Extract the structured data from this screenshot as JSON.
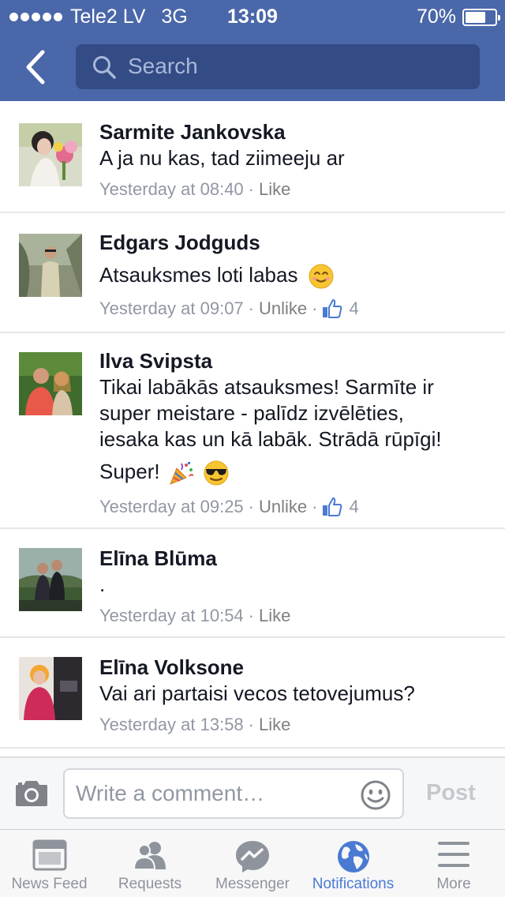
{
  "status_bar": {
    "carrier": "Tele2 LV",
    "network": "3G",
    "time": "13:09",
    "battery": "70%",
    "battery_level": 0.7
  },
  "header": {
    "search_placeholder": "Search",
    "colors": {
      "bar": "#4a67a9",
      "search": "#334c86"
    }
  },
  "comments": [
    {
      "name": "Sarmite Jankovska",
      "lines": [
        "A ja nu kas, tad ziimeeju ar"
      ],
      "time": "Yesterday at 08:40",
      "action": "Like",
      "likes": ""
    },
    {
      "name": "Edgars Jodguds",
      "lines": [
        "Atsauksmes loti labas"
      ],
      "emojis": [
        "smiling-face"
      ],
      "time": "Yesterday at 09:07",
      "action": "Unlike",
      "likes": "4"
    },
    {
      "name": "Ilva Svipsta",
      "lines": [
        "Tikai labākās atsauksmes! Sarmīte ir",
        "super meistare - palīdz izvēlēties,",
        "iesaka kas un kā labāk. Strādā rūpīgi!",
        "Super!"
      ],
      "emojis": [
        "party-popper",
        "sunglasses-face"
      ],
      "time": "Yesterday at 09:25",
      "action": "Unlike",
      "likes": "4"
    },
    {
      "name": "Elīna Blūma",
      "lines": [
        "."
      ],
      "time": "Yesterday at 10:54",
      "action": "Like",
      "likes": ""
    },
    {
      "name": "Elīna Volksone",
      "lines": [
        "Vai ari partaisi vecos tetovejumus?"
      ],
      "time": "Yesterday at 13:58",
      "action": "Like",
      "likes": ""
    }
  ],
  "composer": {
    "placeholder": "Write a comment…",
    "post_label": "Post"
  },
  "tabs": [
    {
      "label": "News Feed",
      "icon": "news-feed-icon",
      "active": false
    },
    {
      "label": "Requests",
      "icon": "friends-icon",
      "active": false
    },
    {
      "label": "Messenger",
      "icon": "messenger-icon",
      "active": false
    },
    {
      "label": "Notifications",
      "icon": "globe-icon",
      "active": true
    },
    {
      "label": "More",
      "icon": "menu-icon",
      "active": false
    }
  ],
  "meta_separator": "·"
}
